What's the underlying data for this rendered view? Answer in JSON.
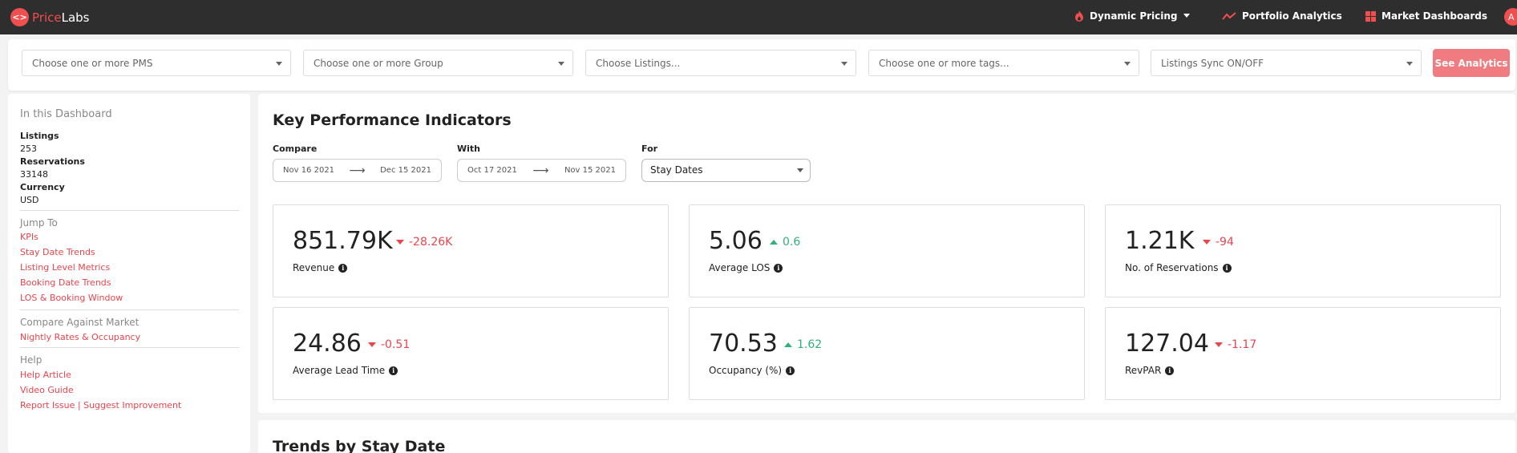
{
  "nav": {
    "logo_price": "Price",
    "logo_labs": "Labs",
    "dynamic_pricing": "Dynamic Pricing",
    "portfolio_analytics": "Portfolio Analytics",
    "market_dashboards": "Market Dashboards",
    "avatar_initial": "A"
  },
  "filters": {
    "pms_placeholder": "Choose one or more PMS",
    "group_placeholder": "Choose one or more Group",
    "listings_placeholder": "Choose Listings...",
    "tags_placeholder": "Choose one or more tags...",
    "sync_placeholder": "Listings Sync ON/OFF",
    "see_analytics": "See Analytics"
  },
  "sidebar": {
    "heading": "In this Dashboard",
    "listings_label": "Listings",
    "listings_value": "253",
    "reservations_label": "Reservations",
    "reservations_value": "33148",
    "currency_label": "Currency",
    "currency_value": "USD",
    "jump_to": "Jump To",
    "jump_links": [
      "KPIs",
      "Stay Date Trends",
      "Listing Level Metrics",
      "Booking Date Trends",
      "LOS & Booking Window"
    ],
    "compare_heading": "Compare Against Market",
    "compare_links": [
      "Nightly Rates & Occupancy"
    ],
    "help_heading": "Help",
    "help_links": [
      "Help Article",
      "Video Guide",
      "Report Issue | Suggest Improvement"
    ]
  },
  "kpi_section": {
    "title": "Key Performance Indicators",
    "compare_label": "Compare",
    "compare_start": "Nov 16 2021",
    "compare_end": "Dec 15 2021",
    "with_label": "With",
    "with_start": "Oct 17 2021",
    "with_end": "Nov 15 2021",
    "for_label": "For",
    "for_value": "Stay Dates",
    "cards": [
      {
        "value": "851.79K",
        "delta": "-28.26K",
        "direction": "down",
        "name": "Revenue"
      },
      {
        "value": "5.06",
        "delta": "0.6",
        "direction": "up",
        "name": "Average LOS"
      },
      {
        "value": "1.21K",
        "delta": "-94",
        "direction": "down",
        "name": "No. of Reservations"
      },
      {
        "value": "24.86",
        "delta": "-0.51",
        "direction": "down",
        "name": "Average Lead Time"
      },
      {
        "value": "70.53",
        "delta": "1.62",
        "direction": "up",
        "name": "Occupancy (%)"
      },
      {
        "value": "127.04",
        "delta": "-1.17",
        "direction": "down",
        "name": "RevPAR"
      }
    ]
  },
  "trends_section": {
    "title": "Trends by Stay Date"
  },
  "colors": {
    "accent": "#ef4f4f",
    "down": "#e8454d",
    "up": "#31b07b",
    "nav_bg": "#2e2e2e"
  }
}
